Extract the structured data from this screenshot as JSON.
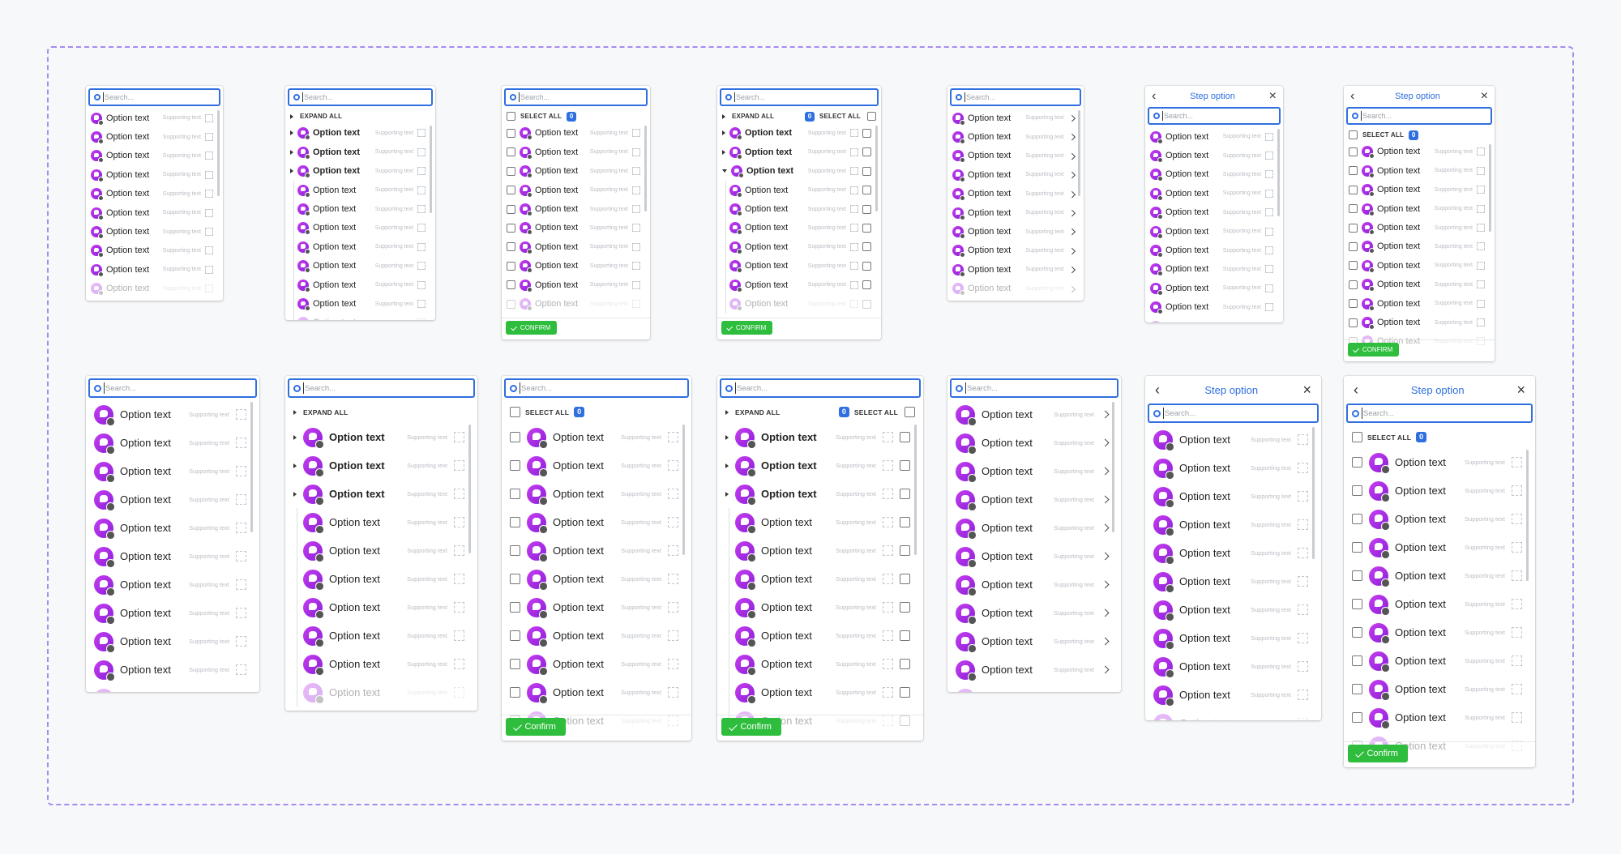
{
  "search_placeholder": "Search...",
  "header_title": "Step option",
  "back_glyph": "‹",
  "close_glyph": "×",
  "expand_all": "EXPAND ALL",
  "select_all": "SELECT ALL",
  "select_count": "0",
  "confirm_small": "CONFIRM",
  "confirm_large": "Confirm",
  "option_text": "Option text",
  "supporting_text": "Supporting text",
  "icons": {
    "search": "search-icon",
    "avatar": "flag-avatar-icon",
    "expand": "expand-icon",
    "chevron": "chevron-right-icon",
    "caret": "caret-right-icon",
    "check": "check-icon"
  },
  "colors": {
    "accent": "#2f6fe0",
    "avatar": "#b32fe8",
    "confirm": "#2ebd3c",
    "frame": "#a58cf0"
  }
}
